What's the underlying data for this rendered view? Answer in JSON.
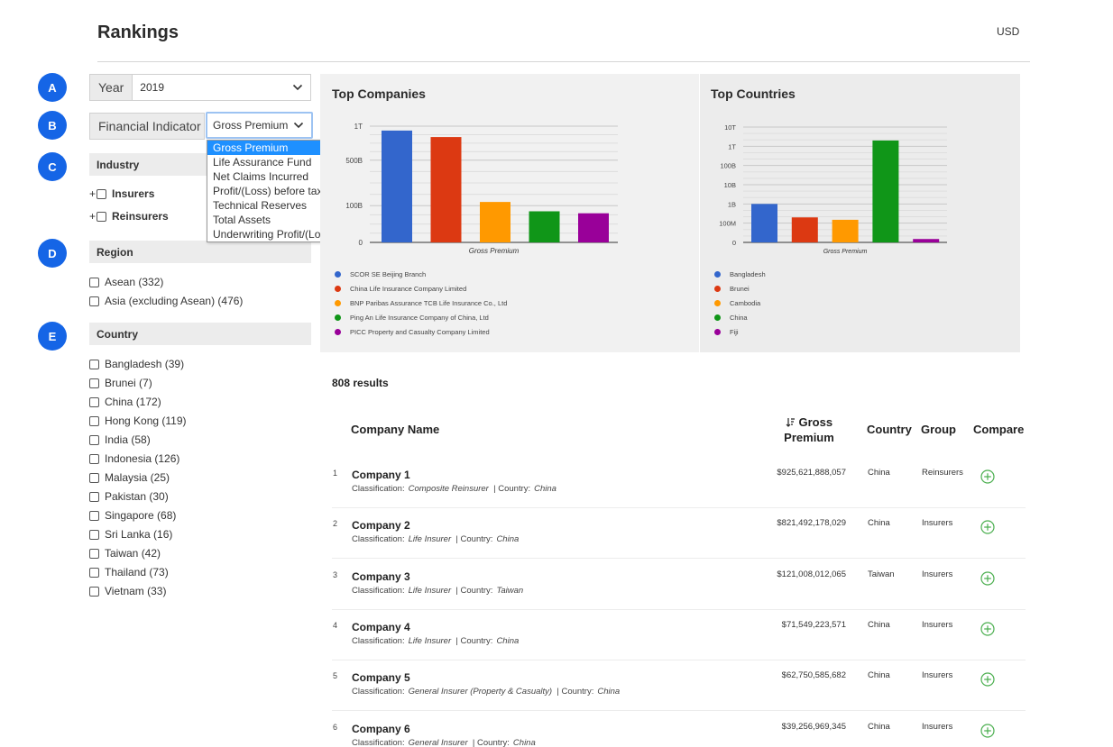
{
  "header": {
    "title": "Rankings",
    "currency": "USD"
  },
  "steps": [
    "A",
    "B",
    "C",
    "D",
    "E"
  ],
  "year": {
    "label": "Year",
    "value": "2019"
  },
  "financial_indicator": {
    "label": "Financial Indicator",
    "value": "Gross Premium",
    "options": [
      "Gross Premium",
      "Life Assurance Fund",
      "Net Claims Incurred",
      "Profit/(Loss) before tax",
      "Technical Reserves",
      "Total Assets",
      "Underwriting Profit/(Loss)"
    ]
  },
  "industry": {
    "title": "Industry",
    "items": [
      "Insurers",
      "Reinsurers"
    ]
  },
  "region": {
    "title": "Region",
    "items": [
      "Asean (332)",
      "Asia (excluding Asean) (476)"
    ]
  },
  "country_filter": {
    "title": "Country",
    "items": [
      "Bangladesh (39)",
      "Brunei (7)",
      "China (172)",
      "Hong Kong (119)",
      "India (58)",
      "Indonesia (126)",
      "Malaysia (25)",
      "Pakistan (30)",
      "Singapore (68)",
      "Sri Lanka (16)",
      "Taiwan (42)",
      "Thailand (73)",
      "Vietnam (33)"
    ]
  },
  "colors": {
    "blue": "#3366cc",
    "red": "#dc3912",
    "orange": "#ff9900",
    "green": "#109618",
    "purple": "#990099",
    "accent": "#1565e6",
    "compare": "#4caf50"
  },
  "chart_data": [
    {
      "type": "bar",
      "title": "Top Companies",
      "xlabel": "Gross Premium",
      "yscale": "sqrt",
      "yticks": [
        "0",
        "100B",
        "500B",
        "1T"
      ],
      "series": [
        {
          "name": "SCOR SE Beijing Branch",
          "value": 925621888057,
          "color": "#3366cc"
        },
        {
          "name": "China Life Insurance Company Limited",
          "value": 821492178029,
          "color": "#dc3912"
        },
        {
          "name": "BNP Paribas Assurance TCB Life Insurance Co., Ltd",
          "value": 121008012065,
          "color": "#ff9900"
        },
        {
          "name": "Ping An Life Insurance Company of China, Ltd",
          "value": 71549223571,
          "color": "#109618"
        },
        {
          "name": "PICC Property and Casualty Company Limited",
          "value": 62750585682,
          "color": "#990099"
        }
      ]
    },
    {
      "type": "bar",
      "title": "Top Countries",
      "xlabel": "Gross Premium",
      "yscale": "log",
      "yticks": [
        "0",
        "100M",
        "1B",
        "10B",
        "100B",
        "1T",
        "10T"
      ],
      "series": [
        {
          "name": "Bangladesh",
          "value": 1000000000,
          "color": "#3366cc"
        },
        {
          "name": "Brunei",
          "value": 200000000,
          "color": "#dc3912"
        },
        {
          "name": "Cambodia",
          "value": 150000000,
          "color": "#ff9900"
        },
        {
          "name": "China",
          "value": 2000000000000,
          "color": "#109618"
        },
        {
          "name": "Fiji",
          "value": 15000000,
          "color": "#990099"
        }
      ]
    }
  ],
  "results": {
    "count_label": "808 results",
    "columns": {
      "name": "Company Name",
      "premium_sort_icon": "sort-desc-icon",
      "premium": "Gross\nPremium",
      "country": "Country",
      "group": "Group",
      "compare": "Compare"
    },
    "classification_label": "Classification:",
    "country_label": "Country:",
    "rows": [
      {
        "rank": "1",
        "name": "Company 1",
        "classification": "Composite Reinsurer",
        "country": "China",
        "premium": "$925,621,888,057",
        "group": "Reinsurers"
      },
      {
        "rank": "2",
        "name": "Company 2",
        "classification": "Life Insurer",
        "country": "China",
        "premium": "$821,492,178,029",
        "group": "Insurers"
      },
      {
        "rank": "3",
        "name": "Company 3",
        "classification": "Life Insurer",
        "country": "Taiwan",
        "premium": "$121,008,012,065",
        "group": "Insurers"
      },
      {
        "rank": "4",
        "name": "Company 4",
        "classification": "Life Insurer",
        "country": "China",
        "premium": "$71,549,223,571",
        "group": "Insurers"
      },
      {
        "rank": "5",
        "name": "Company 5",
        "classification": "General Insurer (Property & Casualty)",
        "country": "China",
        "premium": "$62,750,585,682",
        "group": "Insurers"
      },
      {
        "rank": "6",
        "name": "Company 6",
        "classification": "General Insurer",
        "country": "China",
        "premium": "$39,256,969,345",
        "group": "Insurers"
      }
    ]
  }
}
